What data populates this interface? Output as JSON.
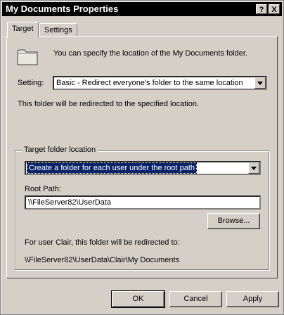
{
  "window": {
    "title": "My Documents Properties",
    "help_button": "?",
    "close_button": "X"
  },
  "tabs": [
    {
      "label": "Target"
    },
    {
      "label": "Settings"
    }
  ],
  "target": {
    "intro_text": "You can specify the location of the My Documents folder.",
    "setting_label": "Setting:",
    "setting_value": "Basic - Redirect everyone's folder to the same location",
    "redirect_info": "This folder will be redirected to the specified location.",
    "group_label": "Target folder location",
    "target_option_value": "Create a folder for each user under the root path",
    "root_path_label": "Root Path:",
    "root_path_value": "\\\\FileServer82\\UserData",
    "browse_label": "Browse...",
    "user_note": "For user Clair, this folder will be redirected to:",
    "resolved_path": "\\\\FileServer82\\UserData\\Clair\\My Documents"
  },
  "footer": {
    "ok_label": "OK",
    "cancel_label": "Cancel",
    "apply_label": "Apply"
  }
}
